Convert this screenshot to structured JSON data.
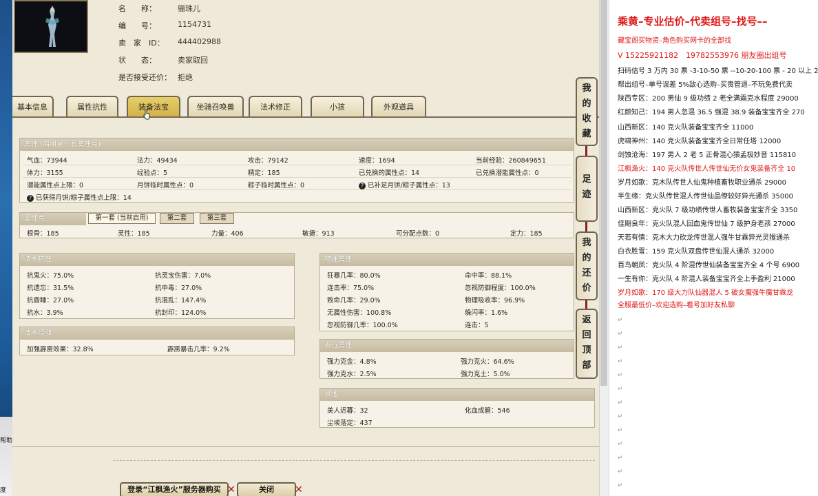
{
  "desktop": {
    "snippet_1": "帮助",
    "snippet_2": "度"
  },
  "char": {
    "name_label": "名　　称：",
    "name": "骊珠儿",
    "id_label": "编　　号：",
    "id": "1154731",
    "seller_label": "卖　家　ID：",
    "seller": "444402988",
    "status_label": "状　　态：",
    "status": "卖家取回",
    "counter_label": "是否接受还价：",
    "counter": "拒绝"
  },
  "tabs": [
    "基本信息",
    "属性抗性",
    "装备法宝",
    "坐骑召唤兽",
    "法术修正",
    "小孩",
    "外观道具"
  ],
  "attr_panel": {
    "title": "属性 (启用第一套属性点)",
    "row1": [
      "气血：73944",
      "法力：49434",
      "攻击：79142",
      "速度：1694",
      "当前经验：260849651"
    ],
    "row2": [
      "体力：3155",
      "经验点：5",
      "精定：185",
      "已兑换的属性点：14",
      "已兑换潜能属性点：0"
    ],
    "row3": [
      "潜能属性点上限：0",
      "月饼临时属性点：0",
      "粽子临时属性点：0",
      "已补足月饼/粽子属性点：13"
    ],
    "row4": "已获得月饼/粽子属性点上限：14"
  },
  "points_panel": {
    "title": "属性点",
    "subtabs": [
      "第一套 (当前启用)",
      "第二套",
      "第三套"
    ],
    "row": [
      "根骨：185",
      "灵性：185",
      "力量：406",
      "敏捷：913",
      "可分配点数：0",
      "定力：185"
    ]
  },
  "resist_panel": {
    "title": "法术抗性",
    "left": [
      "抗鬼火：75.0%",
      "抗遗忘：31.5%",
      "抗昏睡：27.0%",
      "抗水：3.9%"
    ],
    "right": [
      "抗灵宝伤害：7.0%",
      "抗中毒：27.0%",
      "抗混乱：147.4%",
      "抗封印：124.0%"
    ]
  },
  "enhance_panel": {
    "title": "法术增强",
    "items": [
      "加强霹雳效果：32.8%",
      "霹雳暴击几率：9.2%"
    ]
  },
  "physical_panel": {
    "title": "物理属性",
    "left": [
      "狂暴几率：80.0%",
      "连击率：75.0%",
      "致命几率：29.0%",
      "无属性伤害：100.8%",
      "忽视防御几率：100.0%"
    ],
    "right": [
      "命中率：88.1%",
      "忽视防御程度：100.0%",
      "物理吸收率：96.9%",
      "躲闪率：1.6%",
      "连击：5"
    ]
  },
  "five_panel": {
    "title": "五行属性",
    "items": [
      "强力克金：4.8%",
      "强力克火：64.6%",
      "强力克水：2.5%",
      "强力克土：5.0%"
    ]
  },
  "other_panel": {
    "title": "其他",
    "items": [
      "美人迟暮：32",
      "化血成碧：546",
      "尘埃落定：437"
    ]
  },
  "side_buttons": [
    {
      "chars": [
        "我",
        "的",
        "收",
        "藏"
      ]
    },
    {
      "chars": [
        "足",
        "迹"
      ]
    },
    {
      "chars": [
        "我",
        "的",
        "还",
        "价"
      ]
    },
    {
      "chars": [
        "返",
        "回",
        "顶",
        "部"
      ]
    }
  ],
  "bottom": {
    "login": "登录“江枫渔火”服务器购买",
    "close": "关闭"
  },
  "doc": {
    "title": "乘黄–专业估价–代卖组号–找号––",
    "lines": [
      {
        "t": "藏宝阁买物资–角色购买网卡的全部找",
        "red": true
      },
      {
        "t": "V 15225921182　19782553976 朋友圈出组号",
        "red": true
      },
      {
        "t": "扫码估号 3 万内 30 票 -3-10-50 票 --10-20-100 票 - 20 以上 2",
        "red": false
      },
      {
        "t": "帮出组号–单号误差 5%敌心选购–买贵管退–不玩免费代卖",
        "red": false
      },
      {
        "t": "陕西专区：200 男仙 9 级功绩 2 老全满霜克水程度 29000",
        "red": false
      },
      {
        "t": "红颜知己：194 男人忽混 36.5 强混 38.9 装备宝宝齐全 270",
        "red": false
      },
      {
        "t": "山西新区：140 克火队装备宝宝齐全 11000",
        "red": false
      },
      {
        "t": "虎啸神州：140 克火队装备宝宝齐全日常任塔 12000",
        "red": false
      },
      {
        "t": "剑蚀沧海：197 男人 2 老 5 正骨混心猿孟极妙音 115810",
        "red": false
      },
      {
        "t": "江枫渔火：140 克火队传世人传世仙无价女鬼装备齐全 10",
        "red": true
      },
      {
        "t": "岁月如歌：克木队传世人仙鬼种植畜牧职业通杀 29000",
        "red": false
      },
      {
        "t": "半生缘：克火队传世混人传世仙品僚较好异光通杀 35000",
        "red": false
      },
      {
        "t": "山西新区：克火队 7 级功绩传世人畜牧装备宝宝齐全 3350",
        "red": false
      },
      {
        "t": "佳期良年：克火队混人回血鬼传世仙 7 级护身老孩 27000",
        "red": false
      },
      {
        "t": "天若有情：克木大力砍龙传世混人强牛甘霖异光灵猴通杀",
        "red": false
      },
      {
        "t": "白衣胜雪：159 克火队双盘传世仙混人通杀 32000",
        "red": false
      },
      {
        "t": "百鸟朝凤：克火队 4 阶混传世仙装备宝宝齐全 4 个号 6900",
        "red": false
      },
      {
        "t": "一生有你：克火队 4 阶混人装备宝宝齐全上手盈利 21000",
        "red": false
      },
      {
        "t": "岁月如歌：170 级大力队仙器混人 5 破女魔强牛魔甘霖龙",
        "red": true
      },
      {
        "t": "全服最低价–欢迎选购–看号加好友私聊",
        "red": true
      }
    ]
  }
}
